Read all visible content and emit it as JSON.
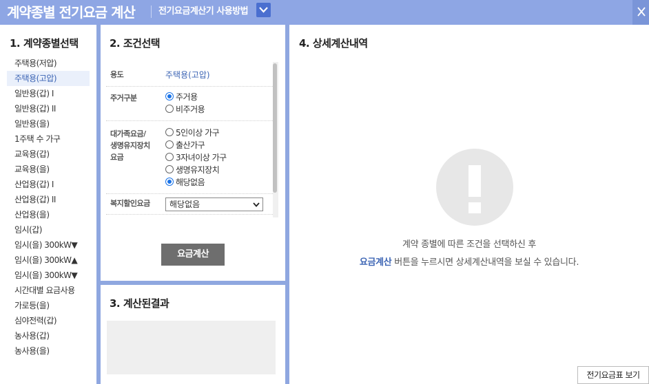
{
  "header": {
    "title": "계약종별 전기요금 계산",
    "help_link": "전기요금계산기 사용방법"
  },
  "contract": {
    "title": "1. 계약종별선택",
    "items": [
      "주택용(저압)",
      "주택용(고압)",
      "일반용(갑) I",
      "일반용(갑) II",
      "일반용(을)",
      "1주택 수 가구",
      "교육용(갑)",
      "교육용(을)",
      "산업용(갑) I",
      "산업용(갑) II",
      "산업용(을)",
      "임시(갑)",
      "임시(을) 300kW▼",
      "임시(을) 300kW▲",
      "임시(을) 300kW▼",
      "시간대별 요금사용",
      "가로등(을)",
      "심야전력(갑)",
      "농사용(갑)",
      "농사용(을)"
    ],
    "selected_index": 1
  },
  "conditions": {
    "title": "2. 조건선택",
    "usage_label": "용도",
    "usage_value": "주택용(고압)",
    "residence_label": "주거구분",
    "residence_options": [
      "주거용",
      "비주거용"
    ],
    "residence_selected": 0,
    "family_label_1": "대가족요금/",
    "family_label_2": "생명유지장치",
    "family_label_3": "요금",
    "family_options": [
      "5인이상 가구",
      "출산가구",
      "3자녀이상 가구",
      "생명유지장치",
      "해당없음"
    ],
    "family_selected": 4,
    "welfare_label": "복지할인요금",
    "welfare_value": "해당없음",
    "date_tilde": "~",
    "calc_button": "요금계산"
  },
  "result": {
    "title": "3. 계산된결과"
  },
  "detail": {
    "title": "4. 상세계산내역",
    "msg_line1": "계약 종별에 따른 조건을 선택하신 후",
    "msg_highlight": "요금계산",
    "msg_line2": " 버튼을 누르시면 상세계산내역을 보실 수 있습니다.",
    "rate_table_button": "전기요금표 보기"
  },
  "colors": {
    "header_bg": "#8ea6e4",
    "accent": "#3d65b4",
    "radio_on": "#1a73e8",
    "calc_button_bg": "#6e6e6e"
  }
}
